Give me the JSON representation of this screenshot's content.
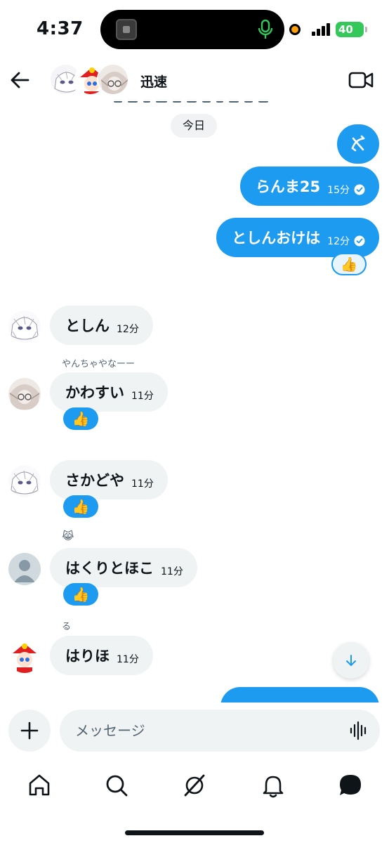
{
  "status_bar": {
    "time": "4:37",
    "battery": "40"
  },
  "header": {
    "group_name": "迅速"
  },
  "chat": {
    "date_label": "今日",
    "messages": [
      {
        "direction": "out",
        "text": "らんま25",
        "time": "15分"
      },
      {
        "direction": "out",
        "text": "としんおけは",
        "time": "12分",
        "reaction": "👍"
      },
      {
        "direction": "in",
        "text": "としん",
        "time": "12分"
      },
      {
        "direction": "in",
        "sender_name": "やんちゃやなーー",
        "text": "かわすい",
        "time": "11分",
        "reaction": "👍"
      },
      {
        "direction": "in",
        "text": "さかどや",
        "time": "11分",
        "reaction": "👍"
      },
      {
        "direction": "in",
        "sender_name": "😹",
        "text": "はくりとほこ",
        "time": "11分",
        "reaction": "👍"
      },
      {
        "direction": "in",
        "sender_name": "る",
        "text": "はりほ",
        "time": "11分"
      }
    ]
  },
  "composer": {
    "placeholder": "メッセージ"
  },
  "colors": {
    "accent": "#1d9bf0",
    "incoming_bubble": "#eff3f4",
    "text": "#0f1419",
    "secondary_text": "#536471"
  },
  "icons": {
    "back": "arrow-left-icon",
    "video": "video-camera-icon",
    "call": "phone-slash-icon",
    "scroll_down": "arrow-down-icon",
    "plus": "plus-icon",
    "voice": "waveform-icon",
    "nav": [
      "home-icon",
      "search-icon",
      "grok-icon",
      "bell-icon",
      "messages-icon"
    ]
  }
}
